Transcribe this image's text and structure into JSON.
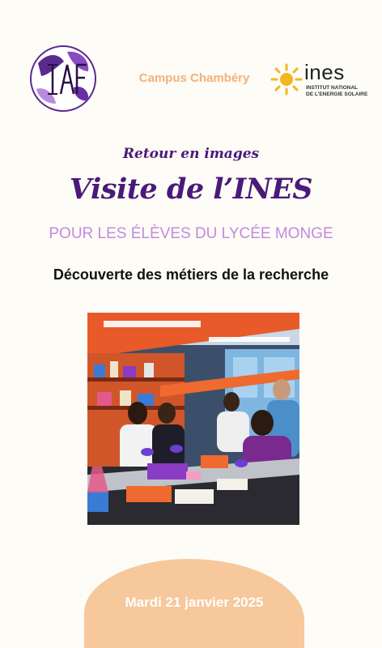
{
  "header": {
    "logo_left_text": "IAF",
    "campus": "Campus Chambéry",
    "ines_logo": {
      "wordmark": "ines",
      "subline_1": "INSTITUT NATIONAL",
      "subline_2": "DE L'ENERGIE SOLAIRE"
    }
  },
  "content": {
    "kicker": "Retour en images",
    "title": "Visite de l’INES",
    "subtitle": "POUR LES ÉLÈVES DU LYCÉE MONGE",
    "tagline": "Découverte des métiers de la recherche"
  },
  "footer": {
    "date": "Mardi 21 janvier 2025"
  },
  "colors": {
    "purple": "#4a1a7a",
    "lilac": "#c28ae0",
    "peach": "#f6c89c",
    "campus_text": "#f2b27a"
  }
}
